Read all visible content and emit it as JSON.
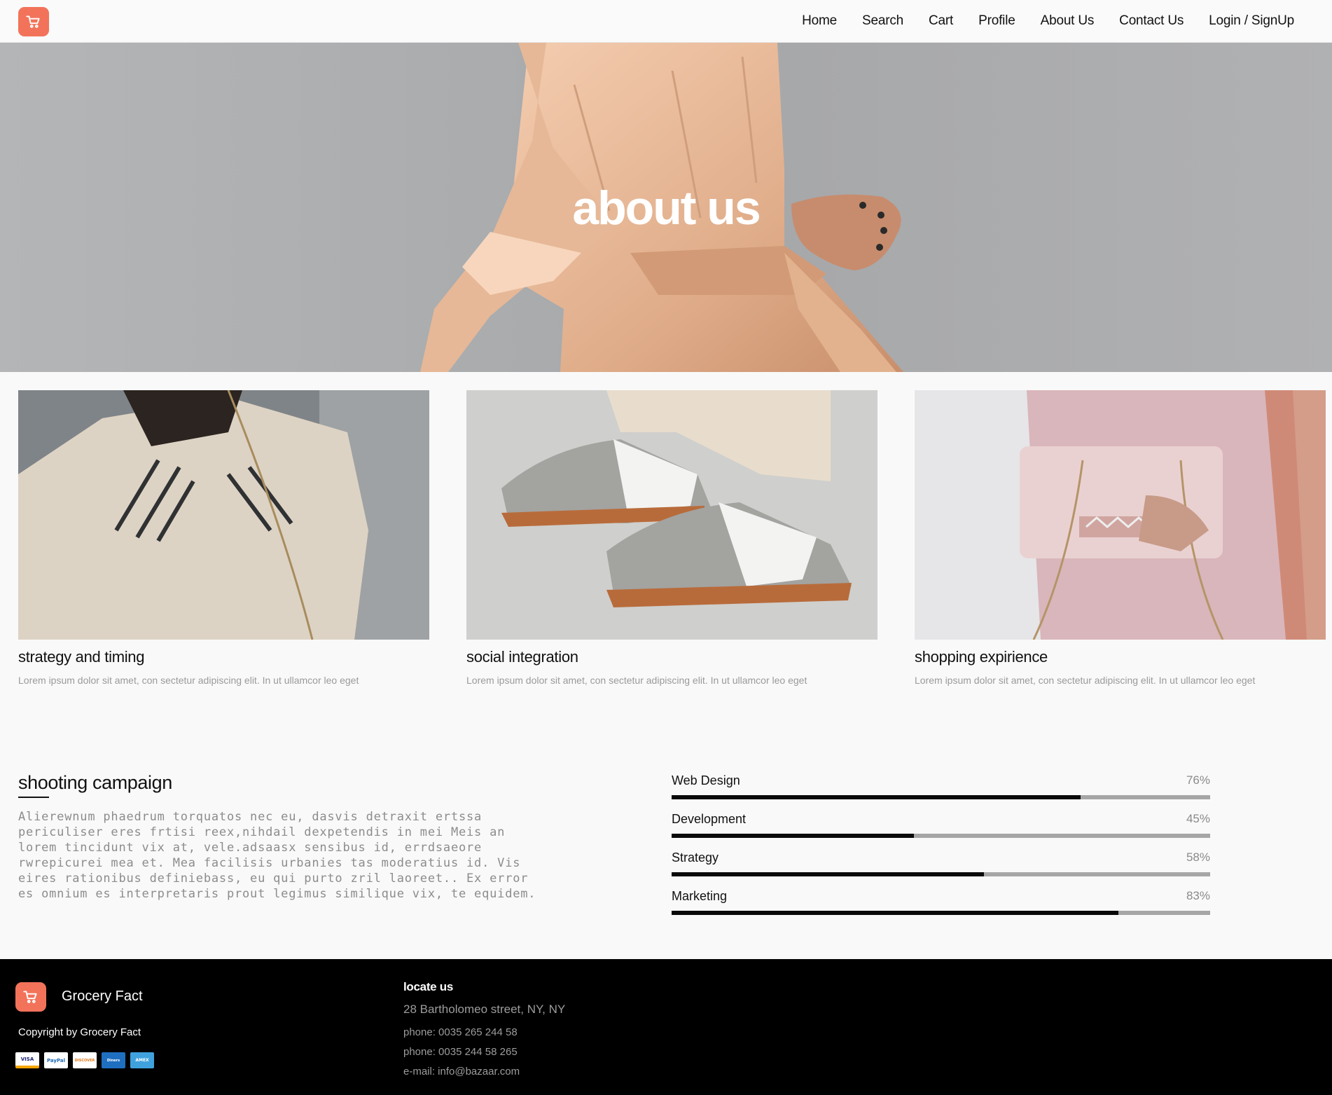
{
  "nav": {
    "logo_icon": "shopping-cart-icon",
    "links": [
      "Home",
      "Search",
      "Cart",
      "Profile",
      "About Us",
      "Contact Us",
      "Login / SignUp"
    ]
  },
  "hero": {
    "title": "about us"
  },
  "cards": [
    {
      "title": "strategy and timing",
      "text": "Lorem ipsum dolor sit amet, con sectetur adipiscing elit. In ut ullamcor leo eget"
    },
    {
      "title": "social integration",
      "text": "Lorem ipsum dolor sit amet, con sectetur adipiscing elit. In ut ullamcor leo eget"
    },
    {
      "title": "shopping expirience",
      "text": "Lorem ipsum dolor sit amet, con sectetur adipiscing elit. In ut ullamcor leo eget"
    }
  ],
  "campaign": {
    "title": "shooting campaign",
    "text": "Alierewnum phaedrum torquatos nec eu, dasvis detraxit ertssa periculiser eres frtisi reex,nihdail dexpetendis in mei Meis an lorem tincidunt vix at, vele.adsaasx sensibus id, errdsaeore rwrepicurei mea et. Mea facilisis urbanies tas moderatius id. Vis eires rationibus definiebass, eu qui purto zril laoreet.. Ex error es omnium es interpretaris prout legimus similique vix, te equidem."
  },
  "skills": [
    {
      "name": "Web Design",
      "percent_label": "76%",
      "value": 76
    },
    {
      "name": "Development",
      "percent_label": "45%",
      "value": 45
    },
    {
      "name": "Strategy",
      "percent_label": "58%",
      "value": 58
    },
    {
      "name": "Marketing",
      "percent_label": "83%",
      "value": 83
    }
  ],
  "footer": {
    "brand": "Grocery Fact",
    "copyright": "Copyright by Grocery Fact",
    "payments": [
      "VISA",
      "PayPal",
      "DISCOVER",
      "Diners",
      "AMEX"
    ],
    "locate_heading": "locate us",
    "address": "28 Bartholomeo street, NY, NY",
    "phone1": "phone: 0035 265 244 58",
    "phone2": "phone: 0035 244 58 265",
    "email": "e-mail: info@bazaar.com"
  },
  "colors": {
    "accent": "#f2735a",
    "footer_bg": "#000000",
    "bar_fill": "#0a0a0a",
    "bar_track": "#a6a6a6"
  }
}
